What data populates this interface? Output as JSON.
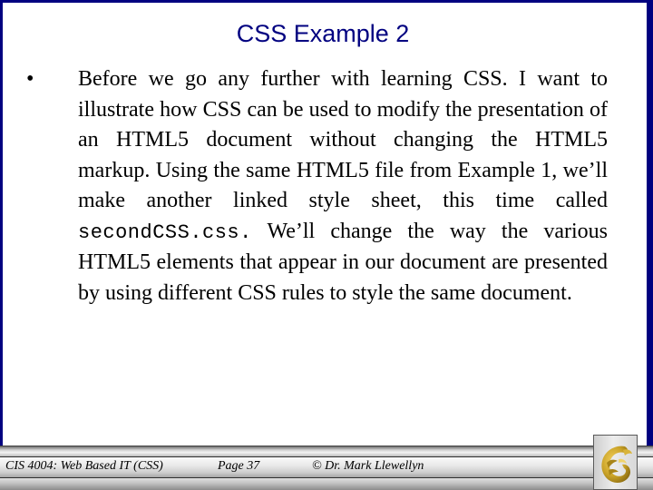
{
  "slide": {
    "title": "CSS Example 2",
    "bullet_glyph": "•",
    "body": {
      "part1": "Before we go any further with learning CSS. I want to illustrate how CSS can be used to modify the presentation of an HTML5 document without changing the HTML5 markup. Using the same HTML5 file from Example 1, we’ll make another linked style sheet, this time called ",
      "code": "secondCSS.css.",
      "part2": " We’ll change the way the various HTML5 elements that appear in our document are presented by using different CSS rules to style the same document."
    }
  },
  "footer": {
    "course": "CIS 4004: Web Based IT (CSS)",
    "page": "Page 37",
    "copyright": "© Dr. Mark Llewellyn",
    "logo_icon": "ucf-pegasus-logo-icon"
  },
  "colors": {
    "frame": "#000080",
    "title": "#000080",
    "logo_gold": "#c9a227"
  }
}
